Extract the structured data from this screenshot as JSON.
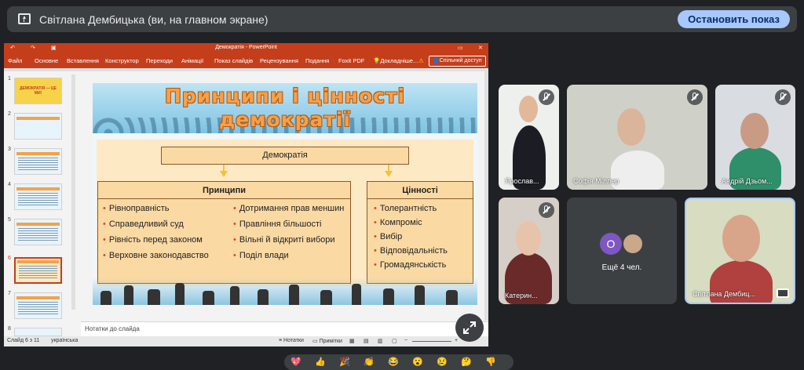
{
  "banner": {
    "title": "Світлана Дембицька (ви, на главном экране)",
    "stop_label": "Остановить показ",
    "share_icon": "present-screen-icon"
  },
  "ppt": {
    "window_title": "Демократія - PowerPoint",
    "tabs": [
      "Файл",
      "Основне",
      "Вставлення",
      "Конструктор",
      "Переходи",
      "Анімації",
      "Показ слайдів",
      "Рецензування",
      "Подання",
      "Foxit PDF",
      "Докладніше..."
    ],
    "share_label": "Спільний доступ",
    "slide_numbers": [
      "1",
      "2",
      "3",
      "4",
      "5",
      "6",
      "7",
      "8"
    ],
    "thumb1_text": "ДЕМОКРАТІЯ — ЦЕ МИ!",
    "notes_placeholder": "Нотатки до слайда",
    "status": {
      "slide_of": "Слайд 6 з 11",
      "language": "українська",
      "notes": "Нотатки",
      "comments": "Примітки"
    },
    "accent_color": "#c43e1c"
  },
  "slide": {
    "title_line1": "Принципи і цінності",
    "title_line2": "демократії",
    "root": "Демократія",
    "principles_title": "Принципи",
    "principles_left": [
      "Рівноправність",
      "Справедливий суд",
      "Рівність перед законом",
      "Верховне законодавство"
    ],
    "principles_right": [
      "Дотримання прав меншин",
      "Правління більшості",
      "Вільні й відкриті вибори",
      "Поділ влади"
    ],
    "values_title": "Цінності",
    "values": [
      "Толерантність",
      "Компроміс",
      "Вибір",
      "Відповідальність",
      "Громадянськість"
    ]
  },
  "participants": [
    {
      "name": "Ярослав..."
    },
    {
      "name": "Софія Міллер"
    },
    {
      "name": "Андрій Дзьом..."
    },
    {
      "name": "Катерин..."
    },
    {
      "name": "Ещё 4 чел.",
      "avatar_letter": "О",
      "avatar_color": "#7e57c2"
    },
    {
      "name": "Світлана Дембиц..."
    }
  ],
  "emoji_bar": [
    "💖",
    "👍",
    "🎉",
    "👏",
    "😂",
    "😮",
    "😢",
    "🤔",
    "👎"
  ]
}
